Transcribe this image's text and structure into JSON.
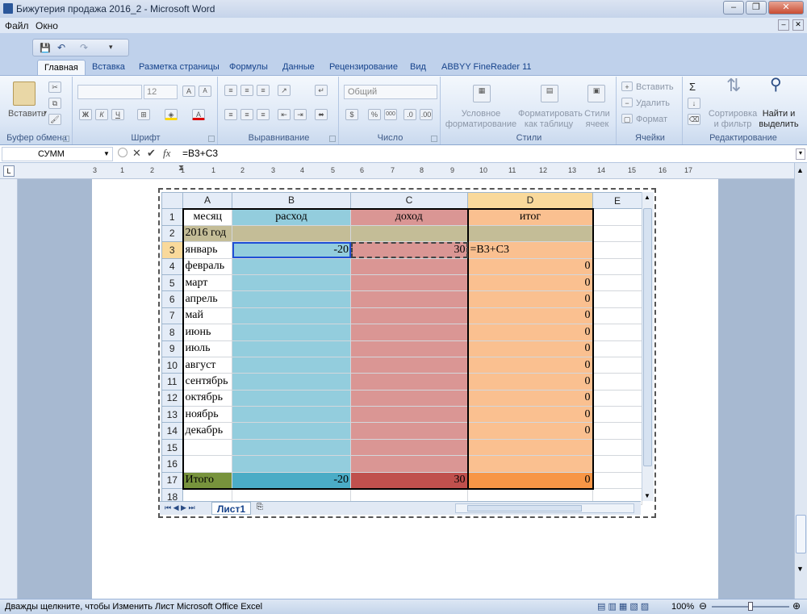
{
  "window": {
    "title": "Бижутерия продажа 2016_2 - Microsoft Word"
  },
  "menu": [
    "Файл",
    "Окно"
  ],
  "tabs": [
    "Главная",
    "Вставка",
    "Разметка страницы",
    "Формулы",
    "Данные",
    "Рецензирование",
    "Вид",
    "ABBYY FineReader 11"
  ],
  "ribbon": {
    "clipboard": {
      "paste": "Вставить",
      "label": "Буфер обмена"
    },
    "font": {
      "size": "12",
      "label": "Шрифт",
      "bold": "Ж",
      "italic": "К",
      "underline": "Ч"
    },
    "alignment": {
      "label": "Выравнивание"
    },
    "number": {
      "format": "Общий",
      "label": "Число",
      "percent": "%",
      "thousands": "000"
    },
    "styles": {
      "cond": "Условное форматирование",
      "table": "Форматировать как таблицу",
      "cells": "Стили ячеек",
      "label": "Стили"
    },
    "cells": {
      "insert": "Вставить",
      "delete": "Удалить",
      "format": "Формат",
      "label": "Ячейки"
    },
    "editing": {
      "sort": "Сортировка и фильтр",
      "find": "Найти и выделить",
      "label": "Редактирование",
      "sum": "Σ"
    }
  },
  "formula_bar": {
    "name_box": "СУММ",
    "formula": "=B3+C3",
    "fx": "fx"
  },
  "ruler": [
    "3",
    "1",
    "2",
    "1",
    "1",
    "2",
    "3",
    "4",
    "5",
    "6",
    "7",
    "8",
    "9",
    "10",
    "11",
    "12",
    "13",
    "14",
    "15",
    "16",
    "17"
  ],
  "sheet": {
    "col_headers": [
      "A",
      "B",
      "C",
      "D",
      "E"
    ],
    "rows": [
      {
        "n": "1",
        "a": "месяц",
        "b": "расход",
        "c": "доход",
        "d": "итог"
      },
      {
        "n": "2",
        "a": "2016 год",
        "b": "",
        "c": "",
        "d": ""
      },
      {
        "n": "3",
        "a": "январь",
        "b": "-20",
        "c": "30",
        "d": "=B3+C3"
      },
      {
        "n": "4",
        "a": "февраль",
        "b": "",
        "c": "",
        "d": "0"
      },
      {
        "n": "5",
        "a": "март",
        "b": "",
        "c": "",
        "d": "0"
      },
      {
        "n": "6",
        "a": "апрель",
        "b": "",
        "c": "",
        "d": "0"
      },
      {
        "n": "7",
        "a": "май",
        "b": "",
        "c": "",
        "d": "0"
      },
      {
        "n": "8",
        "a": "июнь",
        "b": "",
        "c": "",
        "d": "0"
      },
      {
        "n": "9",
        "a": "июль",
        "b": "",
        "c": "",
        "d": "0"
      },
      {
        "n": "10",
        "a": "август",
        "b": "",
        "c": "",
        "d": "0"
      },
      {
        "n": "11",
        "a": "сентябрь",
        "b": "",
        "c": "",
        "d": "0"
      },
      {
        "n": "12",
        "a": "октябрь",
        "b": "",
        "c": "",
        "d": "0"
      },
      {
        "n": "13",
        "a": "ноябрь",
        "b": "",
        "c": "",
        "d": "0"
      },
      {
        "n": "14",
        "a": "декабрь",
        "b": "",
        "c": "",
        "d": "0"
      },
      {
        "n": "15",
        "a": "",
        "b": "",
        "c": "",
        "d": ""
      },
      {
        "n": "16",
        "a": "",
        "b": "",
        "c": "",
        "d": ""
      },
      {
        "n": "17",
        "a": "Итого",
        "b": "-20",
        "c": "30",
        "d": "0"
      },
      {
        "n": "18",
        "a": "",
        "b": "",
        "c": "",
        "d": ""
      }
    ],
    "tab": "Лист1"
  },
  "status": {
    "text": "Дважды щелкните, чтобы Изменить Лист Microsoft Office Excel",
    "zoom": "100%"
  },
  "colors": {
    "rasxod": "#93cddd",
    "doxod": "#da9694",
    "itog": "#fac090",
    "year": "#c4bd97"
  }
}
